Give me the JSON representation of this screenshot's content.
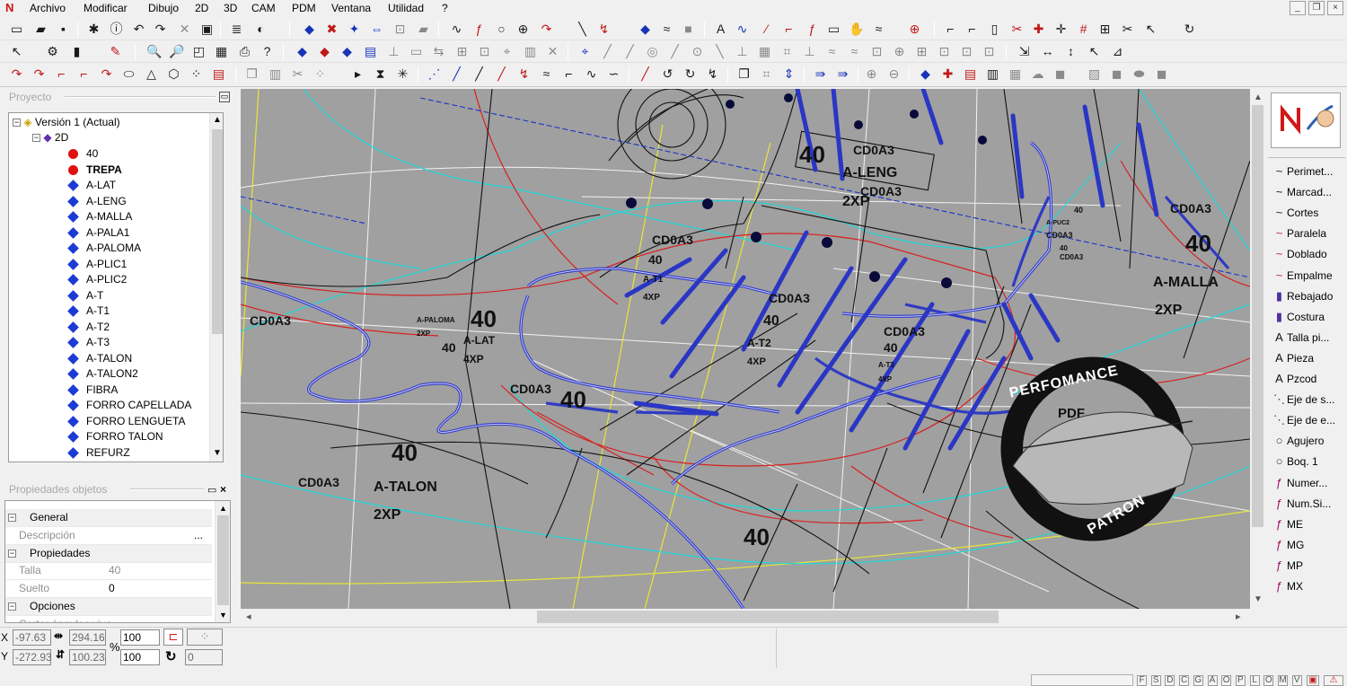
{
  "menu": {
    "items": [
      "Archivo",
      "Modificar",
      "Dibujo",
      "2D",
      "3D",
      "CAM",
      "PDM",
      "Ventana",
      "Utilidad",
      "?"
    ]
  },
  "window_controls": {
    "minimize": "_",
    "restore": "❐",
    "close": "×"
  },
  "project_panel": {
    "title": "Proyecto",
    "root": "Versión 1 (Actual)",
    "child": "2D",
    "items": [
      {
        "label": "40",
        "kind": "red"
      },
      {
        "label": "TREPA",
        "kind": "red",
        "bold": true
      },
      {
        "label": "A-LAT",
        "kind": "blue"
      },
      {
        "label": "A-LENG",
        "kind": "blue"
      },
      {
        "label": "A-MALLA",
        "kind": "blue"
      },
      {
        "label": "A-PALA1",
        "kind": "blue"
      },
      {
        "label": "A-PALOMA",
        "kind": "blue"
      },
      {
        "label": "A-PLIC1",
        "kind": "blue"
      },
      {
        "label": "A-PLIC2",
        "kind": "blue"
      },
      {
        "label": "A-T",
        "kind": "blue"
      },
      {
        "label": "A-T1",
        "kind": "blue"
      },
      {
        "label": "A-T2",
        "kind": "blue"
      },
      {
        "label": "A-T3",
        "kind": "blue"
      },
      {
        "label": "A-TALON",
        "kind": "blue"
      },
      {
        "label": "A-TALON2",
        "kind": "blue"
      },
      {
        "label": "FIBRA",
        "kind": "blue"
      },
      {
        "label": "FORRO CAPELLADA",
        "kind": "blue"
      },
      {
        "label": "FORRO LENGUETA",
        "kind": "blue"
      },
      {
        "label": "FORRO TALON",
        "kind": "blue"
      },
      {
        "label": "REFURZ",
        "kind": "blue"
      }
    ]
  },
  "properties_panel": {
    "title": "Propiedades objetos",
    "rows": [
      {
        "type": "cat",
        "label": "General"
      },
      {
        "type": "field",
        "label": "Descripción",
        "value": "",
        "button": "..."
      },
      {
        "type": "cat",
        "label": "Propiedades"
      },
      {
        "type": "field",
        "label": "Talla",
        "value": "40",
        "readonly": true
      },
      {
        "type": "field",
        "label": "Suelto",
        "value": "0"
      },
      {
        "type": "cat",
        "label": "Opciones"
      },
      {
        "type": "field",
        "label": "Cortar ángulos vivo",
        "value": ""
      }
    ]
  },
  "canvas_labels": [
    {
      "t": "40",
      "sz": 26
    },
    {
      "t": "CD0A3",
      "sz": 14
    },
    {
      "t": "A-LENG",
      "sz": 16
    },
    {
      "t": "CD0A3",
      "sz": 14
    },
    {
      "t": "2XP",
      "sz": 16
    },
    {
      "t": "CD0A3",
      "sz": 14
    },
    {
      "t": "40",
      "sz": 26
    },
    {
      "t": "A-MALLA",
      "sz": 16
    },
    {
      "t": "2XP",
      "sz": 16
    },
    {
      "t": "CD0A3",
      "sz": 14
    },
    {
      "t": "40",
      "sz": 14
    },
    {
      "t": "A-T1",
      "sz": 10
    },
    {
      "t": "4XP",
      "sz": 10
    },
    {
      "t": "CD0A3",
      "sz": 14
    },
    {
      "t": "40",
      "sz": 16
    },
    {
      "t": "A-T2",
      "sz": 12
    },
    {
      "t": "4XP",
      "sz": 11
    },
    {
      "t": "CD0A3",
      "sz": 14
    },
    {
      "t": "40",
      "sz": 14
    },
    {
      "t": "A-T3",
      "sz": 8
    },
    {
      "t": "4XP",
      "sz": 8
    },
    {
      "t": "CD0A3",
      "sz": 14
    },
    {
      "t": "A-PALOMA",
      "sz": 8
    },
    {
      "t": "2XP",
      "sz": 8
    },
    {
      "t": "40",
      "sz": 26
    },
    {
      "t": "40",
      "sz": 14
    },
    {
      "t": "A-LAT",
      "sz": 12
    },
    {
      "t": "4XP",
      "sz": 12
    },
    {
      "t": "CD0A3",
      "sz": 14
    },
    {
      "t": "40",
      "sz": 26
    },
    {
      "t": "40",
      "sz": 26
    },
    {
      "t": "CD0A3",
      "sz": 14
    },
    {
      "t": "A-TALON",
      "sz": 16
    },
    {
      "t": "2XP",
      "sz": 16
    },
    {
      "t": "40",
      "sz": 26
    },
    {
      "t": "40",
      "sz": 9
    },
    {
      "t": "A-PUC2",
      "sz": 7
    },
    {
      "t": "CD0A3",
      "sz": 9
    },
    {
      "t": "40",
      "sz": 8
    },
    {
      "t": "CD0A3",
      "sz": 8
    }
  ],
  "watermark": {
    "top": "PERFOMANCE",
    "middle": "PDF",
    "bottom": "PATRON"
  },
  "right_panel": {
    "items": [
      "Perimet...",
      "Marcad...",
      "Cortes",
      "Paralela",
      "Doblado",
      "Empalme",
      "Rebajado",
      "Costura",
      "Talla pi...",
      "Pieza",
      "Pzcod",
      "Eje de s...",
      "Eje de e...",
      "Agujero",
      "Boq. 1",
      "Numer...",
      "Num.Si...",
      "ME",
      "MG",
      "MP",
      "MX"
    ],
    "icons": [
      "~",
      "~",
      "~",
      "~",
      "~",
      "~",
      "▮",
      "▮",
      "A",
      "A",
      "A",
      "⋱",
      "⋱",
      "○",
      "○",
      "ƒ",
      "ƒ",
      "ƒ",
      "ƒ",
      "ƒ",
      "ƒ"
    ]
  },
  "status": {
    "x_label": "X",
    "y_label": "Y",
    "pct_label": "%",
    "x": "-97.63",
    "y": "-272.93",
    "w": "294.16",
    "h": "100.23",
    "sx": "100",
    "sy": "100",
    "rot": "0",
    "keys": [
      "F",
      "S",
      "D",
      "C",
      "G",
      "A",
      "O",
      "P",
      "L",
      "O",
      "M",
      "V"
    ]
  },
  "colors": {
    "canvas": "#a0a0a0",
    "blue": "#2636c0",
    "red": "#d42020",
    "cyan": "#19d4d4",
    "yellow": "#e8e838",
    "white": "#f4f4f4"
  }
}
